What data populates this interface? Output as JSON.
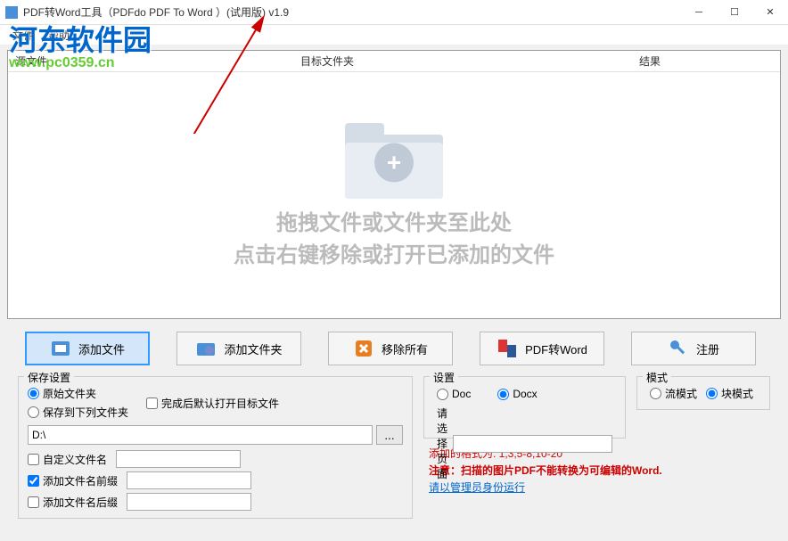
{
  "titlebar": {
    "title": "PDF转Word工具（PDFdo PDF To Word ）(试用版) v1.9"
  },
  "menubar": {
    "file": "文件",
    "help": "帮助"
  },
  "watermark": {
    "cn": "河东软件园",
    "url": "www.pc0359.cn"
  },
  "table": {
    "source": "源文件",
    "target": "目标文件夹",
    "result": "结果"
  },
  "dropzone": {
    "line1": "拖拽文件或文件夹至此处",
    "line2": "点击右键移除或打开已添加的文件"
  },
  "toolbar": {
    "addfile": "添加文件",
    "addfolder": "添加文件夹",
    "removeall": "移除所有",
    "convert": "PDF转Word",
    "register": "注册"
  },
  "save": {
    "title": "保存设置",
    "original": "原始文件夹",
    "tofolder": "保存到下列文件夹",
    "autoopen": "完成后默认打开目标文件",
    "path": "D:\\",
    "customname": "自定义文件名",
    "prefix": "添加文件名前缀",
    "suffix": "添加文件名后缀"
  },
  "settings": {
    "title": "设置",
    "doc": "Doc",
    "docx": "Docx",
    "pagelabel": "请选择页面"
  },
  "mode": {
    "title": "模式",
    "stream": "流模式",
    "block": "块模式"
  },
  "notes": {
    "format": "添加的格式为: 1,3,5-8,10-20",
    "warning": "注意：扫描的图片PDF不能转换为可编辑的Word.",
    "admin": "请以管理员身份运行"
  }
}
